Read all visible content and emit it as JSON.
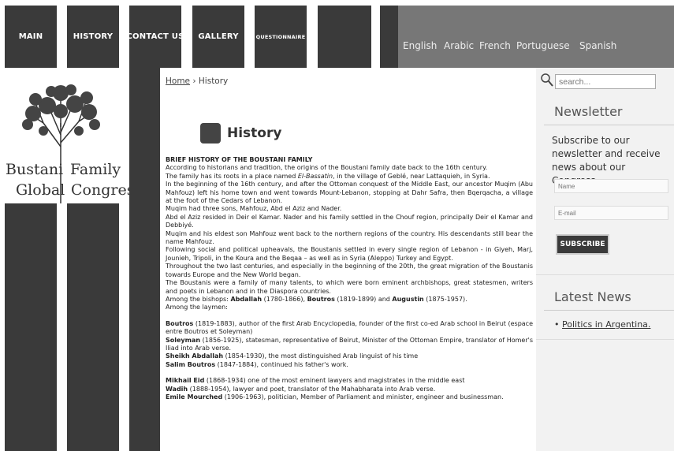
{
  "nav": {
    "items": [
      "MAIN",
      "HISTORY",
      "CONTACT US",
      "GALLERY",
      "QUESTIONNAIRE",
      ""
    ],
    "languages": [
      "English",
      "Arabic",
      "French",
      "Portuguese",
      "Spanish"
    ]
  },
  "logo": {
    "line1a": "Bustani",
    "line1b": "Family",
    "line2a": "Global",
    "line2b": "Congress"
  },
  "breadcrumb": {
    "home": "Home",
    "sep": "›",
    "current": "History"
  },
  "page": {
    "title": "History"
  },
  "article": {
    "heading": "BRIEF HISTORY OF THE BOUSTANI FAMILY",
    "p1": "According to historians and tradition, the origins of the Boustani family date back to the 16th century.",
    "p2a": "The family has its roots in a place named ",
    "p2b": "El-Bassatin",
    "p2c": ", in the village of Geblé, near Lattaquieh, in Syria.",
    "p3": "In the beginning of the 16th century, and after the Ottoman conquest of the Middle East, our ancestor Muqim (Abu Mahfouz) left his home town and went towards Mount-Lebanon, stopping at Dahr Safra, then Bqerqacha, a village at the foot of the Cedars of Lebanon.",
    "p4": "Muqim had three sons, Mahfouz, Abd el Aziz and Nader.",
    "p5": "Abd el Aziz resided in Deir el Kamar. Nader and his family settled in the Chouf region, principally Deir el Kamar and Debbiyé.",
    "p6": "Muqim and his eldest son Mahfouz went back to the northern regions of the country. His descendants still bear the name Mahfouz.",
    "p7": "Following social and political upheavals, the Boustanis settled in every single region of Lebanon - in Giyeh, Marj, Jounieh, Tripoli, in the Koura and the Beqaa – as well as in Syria (Aleppo) Turkey and Egypt.",
    "p8": "Throughout the two last centuries, and especially in the beginning of the 20th, the great migration of the Boustanis towards Europe and the New World began.",
    "p9": "The Boustanis were a family of many talents, to which were born eminent archbishops, great statesmen, writers and poets in Lebanon and in the Diaspora countries.",
    "bishops_lead": "Among the bishops: ",
    "b1": "Abdallah",
    "b1d": " (1780-1866), ",
    "b2": "Boutros",
    "b2d": " (1819-1899) and ",
    "b3": "Augustin",
    "b3d": " (1875-1957).",
    "laymen": "Among the laymen:",
    "l1n": "Boutros",
    "l1": " (1819-1883), author of the first Arab Encyclopedia, founder of the first co-ed Arab school in Beirut (espace entre Boutros et Soleyman)",
    "l2n": "Soleyman",
    "l2": " (1856-1925), statesman, representative of Beirut, Minister of the Ottoman Empire, translator of Homer's Iliad into Arab verse.",
    "l3n": "Sheikh Abdallah",
    "l3": " (1854-1930), the most distinguished Arab linguist of his time",
    "l4n": "Salim Boutros",
    "l4": " (1847-1884), continued his father's work.",
    "m1n": "Mikhail Eid",
    "m1": " (1868-1934) one of the most eminent lawyers and magistrates in the middle east",
    "m2n": "Wadih",
    "m2": " (1888-1954), lawyer and poet, translator of the Mahabharata into Arab verse.",
    "m3n": "Emile Mourched",
    "m3": " (1906-1963), politician, Member of Parliament and minister, engineer and businessman."
  },
  "sidebar": {
    "search_placeholder": "search...",
    "newsletter_title": "Newsletter",
    "newsletter_text": "Subscribe to our newsletter and receive news about our Congress",
    "name_placeholder": "Name",
    "email_placeholder": "E-mail",
    "subscribe_label": "SUBSCRIBE",
    "news_title": "Latest News",
    "news_items": [
      "Politics in Argentina."
    ]
  }
}
